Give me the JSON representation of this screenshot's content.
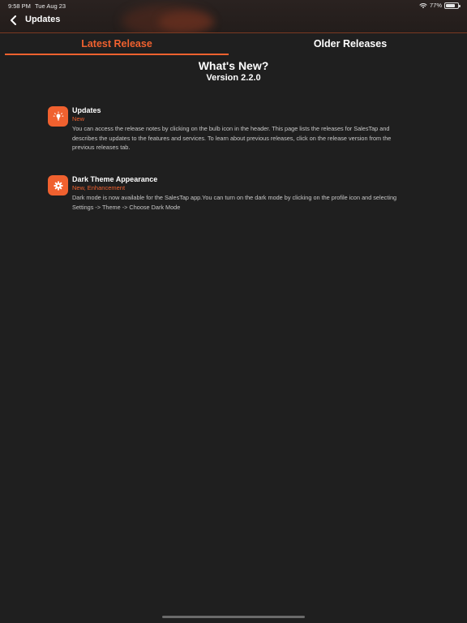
{
  "status_bar": {
    "time": "9:58 PM",
    "date": "Tue Aug 23",
    "battery_percent": "77%",
    "battery_level": 0.77
  },
  "header": {
    "title": "Updates",
    "back_icon": "chevron-left-icon"
  },
  "tabs": [
    {
      "label": "Latest Release",
      "active": true
    },
    {
      "label": "Older Releases",
      "active": false
    }
  ],
  "main": {
    "heading": "What's New?",
    "version": "Version 2.2.0",
    "items": [
      {
        "icon": "bulb-icon",
        "title": "Updates",
        "tag": "New",
        "description": "You can access the release notes by clicking on the bulb icon in the header. This page lists the releases for SalesTap and describes the updates to the features and services. To learn about previous releases, click on the release version from the previous releases tab."
      },
      {
        "icon": "gear-icon",
        "title": "Dark Theme Appearance",
        "tag": "New, Enhancement",
        "description": "Dark mode is now available for the SalesTap app.You can turn on the dark mode by clicking on the profile icon and selecting Settings -> Theme -> Choose Dark Mode"
      }
    ]
  },
  "colors": {
    "accent": "#f0612f",
    "background": "#1f1f1f",
    "text": "#ffffff",
    "muted_text": "#c8c8c8"
  }
}
